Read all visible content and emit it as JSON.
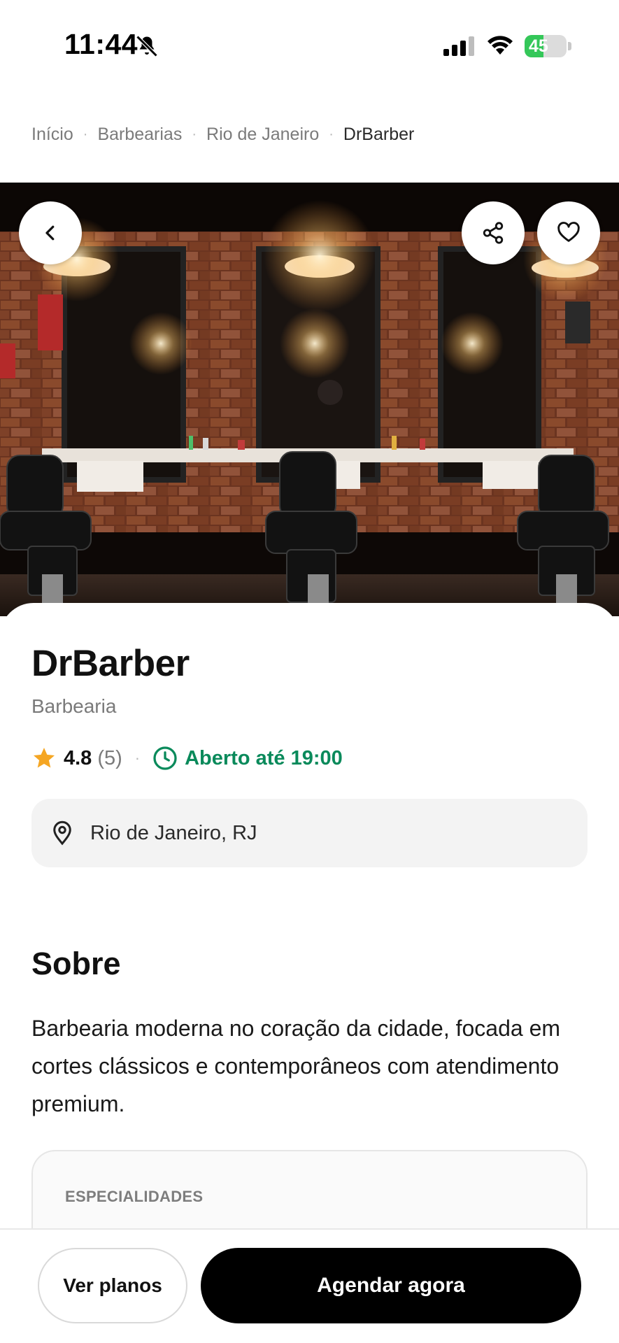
{
  "status_bar": {
    "time": "11:44",
    "battery_level": "45",
    "battery_fraction": 0.45,
    "icons": [
      "bell-slash-icon",
      "cellular-signal-icon",
      "wifi-icon",
      "battery-charging-icon"
    ]
  },
  "breadcrumb": {
    "items": [
      "Início",
      "Barbearias",
      "Rio de Janeiro",
      "DrBarber"
    ],
    "separator": "·"
  },
  "hero": {
    "description_icon_names": [
      "back-icon",
      "share-icon",
      "heart-icon"
    ]
  },
  "shop": {
    "name": "DrBarber",
    "category": "Barbearia",
    "rating": "4.8",
    "review_count": "(5)",
    "open_status": "Aberto até 19:00",
    "location": "Rio de Janeiro, RJ"
  },
  "about": {
    "title": "Sobre",
    "text": "Barbearia moderna no coração da cidade, focada em cortes clássicos e contemporâneos com atendimento premium."
  },
  "specialties": {
    "label": "ESPECIALIDADES"
  },
  "actions": {
    "plans_label": "Ver planos",
    "book_label": "Agendar agora"
  },
  "colors": {
    "accent_green": "#0a8a5b",
    "star": "#f5a623",
    "primary_button": "#000000",
    "battery_green": "#34c759"
  }
}
